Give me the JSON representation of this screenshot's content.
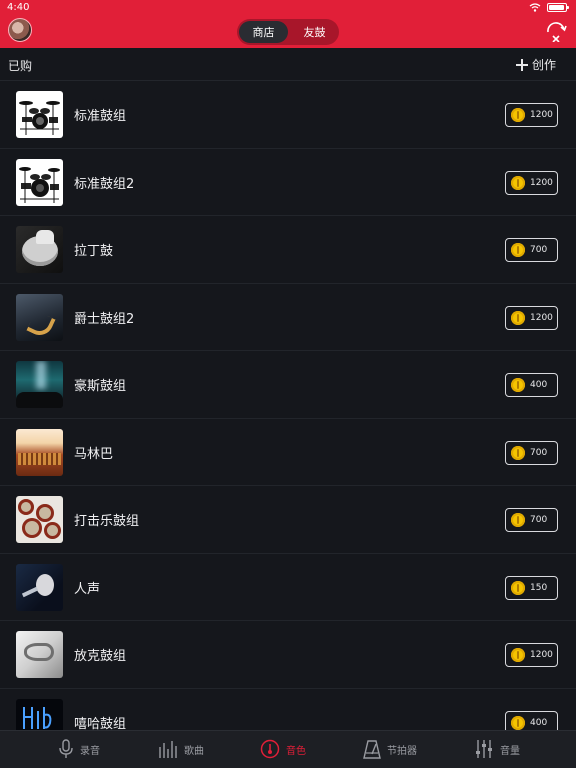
{
  "status_bar": {
    "time": "4:40"
  },
  "header": {
    "segments": [
      {
        "label": "商店",
        "active": true
      },
      {
        "label": "友鼓",
        "active": false
      }
    ]
  },
  "subheader": {
    "title": "已购",
    "create_label": "创作"
  },
  "items": [
    {
      "name": "标准鼓组",
      "price": "1200",
      "thumb": "drum-kit"
    },
    {
      "name": "标准鼓组2",
      "price": "1200",
      "thumb": "drum-kit"
    },
    {
      "name": "拉丁鼓",
      "price": "700",
      "thumb": "latin-drum"
    },
    {
      "name": "爵士鼓组2",
      "price": "1200",
      "thumb": "saxophone"
    },
    {
      "name": "豪斯鼓组",
      "price": "400",
      "thumb": "concert-crowd"
    },
    {
      "name": "马林巴",
      "price": "700",
      "thumb": "marimba"
    },
    {
      "name": "打击乐鼓组",
      "price": "700",
      "thumb": "percussion"
    },
    {
      "name": "人声",
      "price": "150",
      "thumb": "vocalist"
    },
    {
      "name": "放克鼓组",
      "price": "1200",
      "thumb": "brass"
    },
    {
      "name": "嘻哈鼓组",
      "price": "400",
      "thumb": "neon"
    }
  ],
  "tabbar": [
    {
      "label": "录音",
      "icon": "microphone-icon",
      "active": false
    },
    {
      "label": "歌曲",
      "icon": "bars-icon",
      "active": false
    },
    {
      "label": "音色",
      "icon": "tone-icon",
      "active": true
    },
    {
      "label": "节拍器",
      "icon": "metronome-icon",
      "active": false
    },
    {
      "label": "音量",
      "icon": "sliders-icon",
      "active": false
    }
  ],
  "colors": {
    "accent": "#e11f38",
    "background": "#15171c",
    "coin": "#f5c400"
  }
}
